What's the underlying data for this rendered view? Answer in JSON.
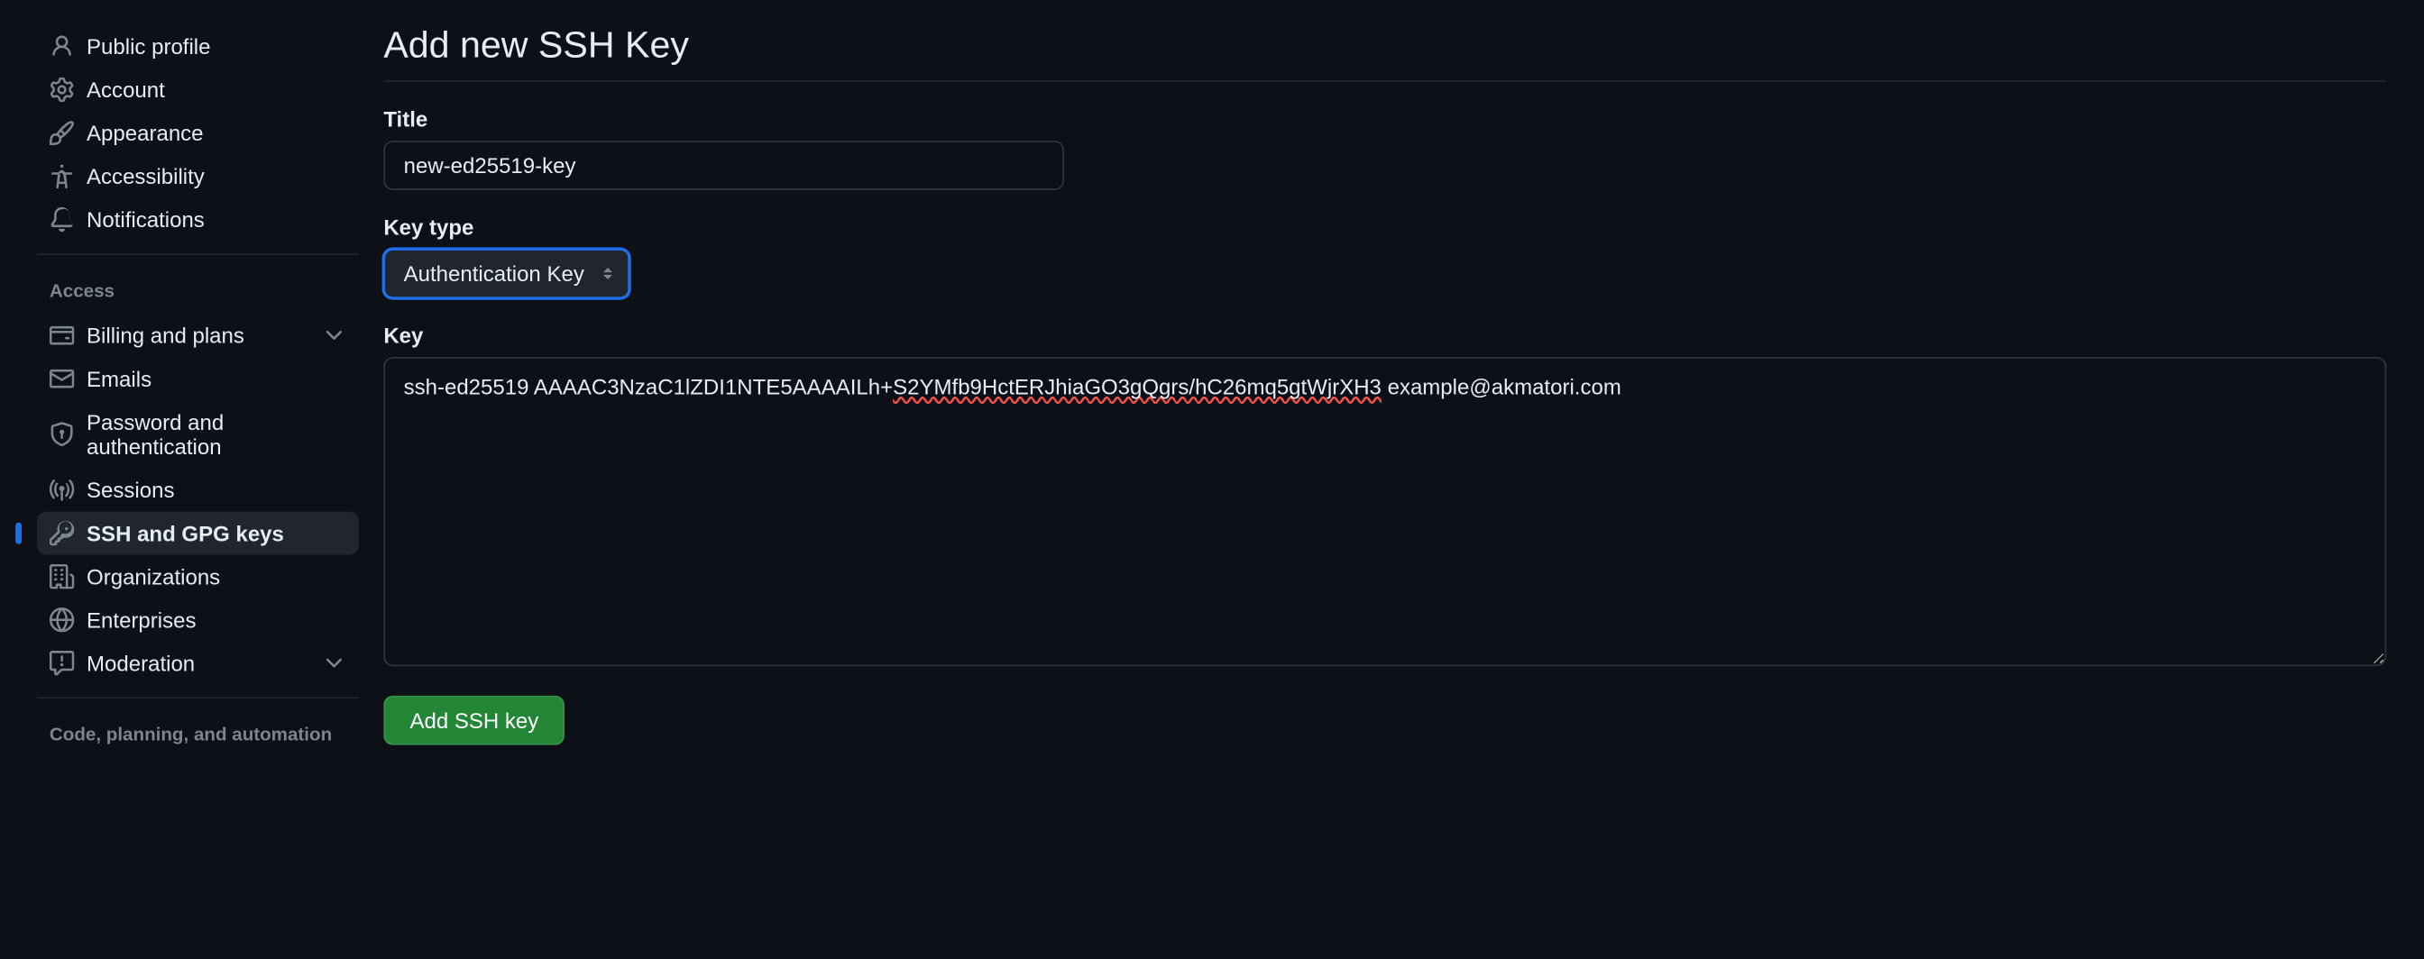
{
  "sidebar": {
    "group1": [
      {
        "label": "Public profile",
        "icon": "person"
      },
      {
        "label": "Account",
        "icon": "gear"
      },
      {
        "label": "Appearance",
        "icon": "paintbrush"
      },
      {
        "label": "Accessibility",
        "icon": "accessibility"
      },
      {
        "label": "Notifications",
        "icon": "bell"
      }
    ],
    "section_access": "Access",
    "group2": [
      {
        "label": "Billing and plans",
        "icon": "credit-card",
        "expandable": true
      },
      {
        "label": "Emails",
        "icon": "mail"
      },
      {
        "label": "Password and authentication",
        "icon": "shield-lock"
      },
      {
        "label": "Sessions",
        "icon": "broadcast"
      },
      {
        "label": "SSH and GPG keys",
        "icon": "key",
        "active": true
      },
      {
        "label": "Organizations",
        "icon": "organization"
      },
      {
        "label": "Enterprises",
        "icon": "globe"
      },
      {
        "label": "Moderation",
        "icon": "report",
        "expandable": true
      }
    ],
    "section_code": "Code, planning, and automation"
  },
  "page": {
    "title": "Add new SSH Key",
    "title_label": "Title",
    "title_value": "new-ed25519-key",
    "keytype_label": "Key type",
    "keytype_value": "Authentication Key",
    "key_label": "Key",
    "key_value_plain": "ssh-ed25519 AAAAC3NzaC1lZDI1NTE5AAAAILh+S2YMfb9HctERJhiaGO3gQgrs/hC26mq5gtWjrXH3 example@akmatori.com",
    "key_value_pre": "ssh-ed25519 AAAAC3NzaC1lZDI1NTE5AAAAILh+",
    "key_value_err": "S2YMfb9HctERJhiaGO3gQgrs/hC26mq5gtWjrXH3",
    "key_value_post": " example@akmatori.com",
    "submit_label": "Add SSH key"
  }
}
